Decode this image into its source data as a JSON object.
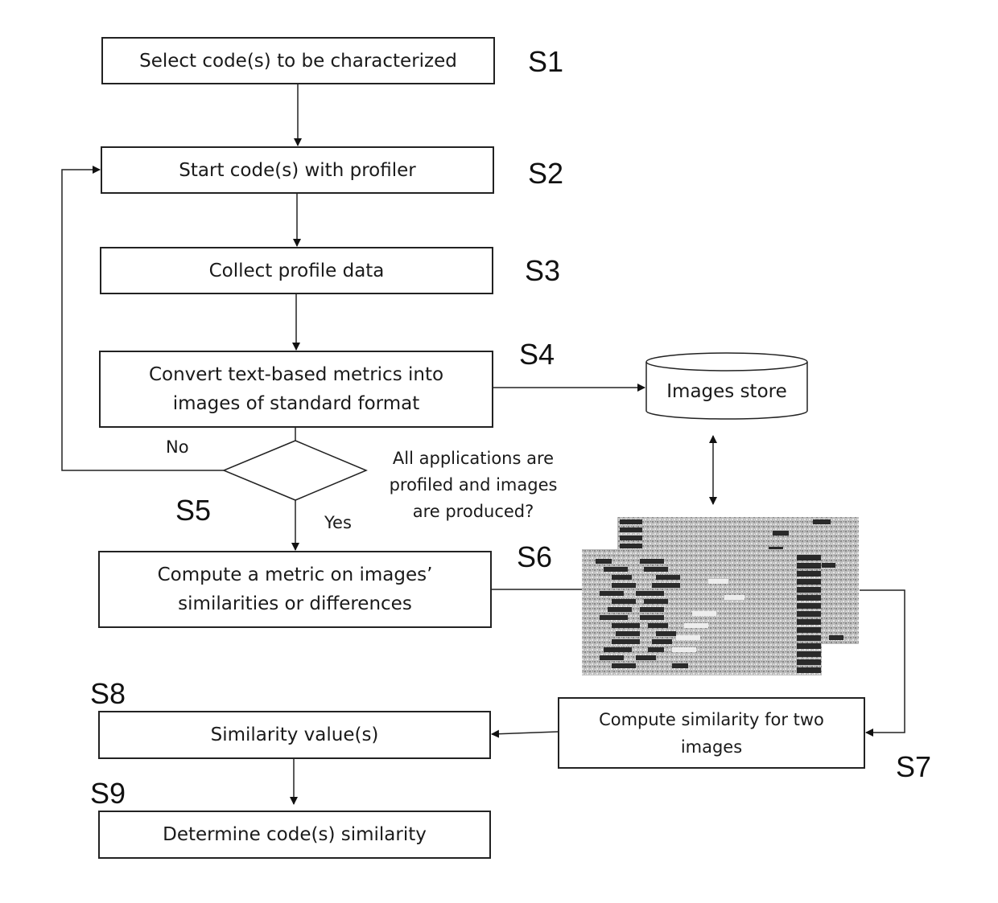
{
  "steps": {
    "s1": {
      "id": "S1",
      "text": "Select code(s) to be characterized"
    },
    "s2": {
      "id": "S2",
      "text": "Start code(s) with profiler"
    },
    "s3": {
      "id": "S3",
      "text": "Collect profile data"
    },
    "s4": {
      "id": "S4",
      "text_line1": "Convert text-based metrics into",
      "text_line2": "images of standard format"
    },
    "s5": {
      "id": "S5",
      "question_line1": "All applications are",
      "question_line2": "profiled and images",
      "question_line3": "are produced?",
      "no": "No",
      "yes": "Yes"
    },
    "s6": {
      "id": "S6",
      "text_line1": "Compute a metric on images’",
      "text_line2": "similarities or differences"
    },
    "s7": {
      "id": "S7",
      "text_line1": "Compute similarity for two",
      "text_line2": "images"
    },
    "s8": {
      "id": "S8",
      "text": "Similarity value(s)"
    },
    "s9": {
      "id": "S9",
      "text": "Determine code(s) similarity"
    }
  },
  "store": {
    "text": "Images store"
  },
  "colors": {
    "line": "#222222",
    "background": "#ffffff"
  }
}
